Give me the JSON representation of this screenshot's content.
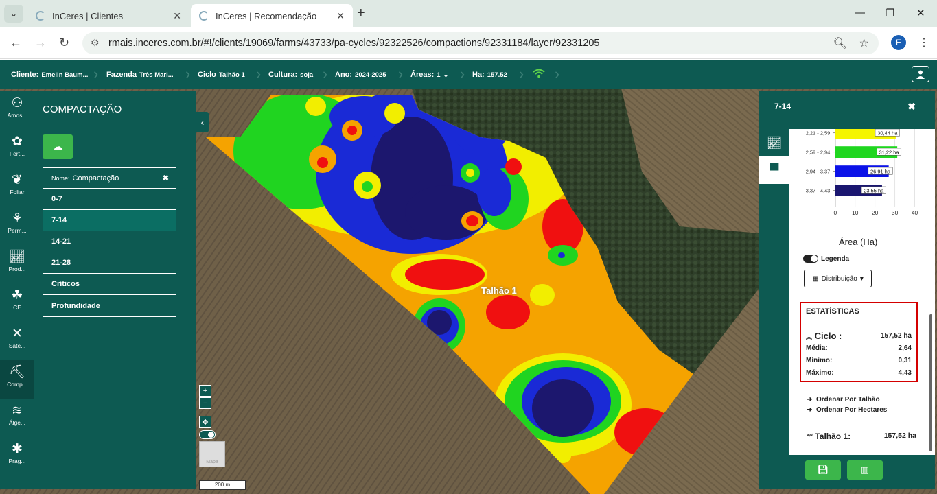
{
  "browser": {
    "tabs": [
      {
        "title": "InCeres | Clientes",
        "active": false
      },
      {
        "title": "InCeres | Recomendação",
        "active": true
      }
    ],
    "url": "rmais.inceres.com.br/#!/clients/19069/farms/43733/pa-cycles/92322526/compactions/92331184/layer/92331205",
    "profile_initial": "E"
  },
  "header": {
    "cliente_label": "Cliente:",
    "cliente_value": "Emelin Baum...",
    "fazenda_label": "Fazenda",
    "fazenda_value": "Três Mari...",
    "ciclo_label": "Ciclo",
    "ciclo_value": "Talhão 1",
    "cultura_label": "Cultura:",
    "cultura_value": "soja",
    "ano_label": "Ano:",
    "ano_value": "2024-2025",
    "areas_label": "Áreas:",
    "areas_value": "1",
    "ha_label": "Ha:",
    "ha_value": "157.52"
  },
  "sidebar": {
    "items": [
      {
        "label": "Amos...",
        "icon": "sample-icon"
      },
      {
        "label": "Fert...",
        "icon": "fertilizer-icon"
      },
      {
        "label": "Foliar",
        "icon": "leaf-icon"
      },
      {
        "label": "Perm...",
        "icon": "permission-icon"
      },
      {
        "label": "Prod...",
        "icon": "productivity-icon"
      },
      {
        "label": "CE",
        "icon": "sprout-icon"
      },
      {
        "label": "Sate...",
        "icon": "satellite-icon"
      },
      {
        "label": "Comp...",
        "icon": "compaction-icon"
      },
      {
        "label": "Álge...",
        "icon": "layers-icon"
      },
      {
        "label": "Prag...",
        "icon": "bug-icon"
      }
    ]
  },
  "left_panel": {
    "title": "COMPACTAÇÃO",
    "name_key": "Nome:",
    "name_value": "Compactação",
    "layers": [
      "0-7",
      "7-14",
      "14-21",
      "21-28",
      "Críticos",
      "Profundidade"
    ],
    "selected_layer": "7-14"
  },
  "map": {
    "plot_label": "Talhão 1",
    "scale_label": "200 m",
    "thumb_label": "Mapa"
  },
  "right_panel": {
    "title": "7-14",
    "axis_title": "Área (Ha)",
    "legend_toggle": "Legenda",
    "distribution_button": "Distribuição",
    "stats": {
      "title": "ESTATÍSTICAS",
      "ciclo_label": "Ciclo",
      "ciclo_value": "157,52 ha",
      "media_label": "Média:",
      "media_value": "2,64",
      "minimo_label": "Mínimo:",
      "minimo_value": "0,31",
      "maximo_label": "Máximo:",
      "maximo_value": "4,43"
    },
    "sort_by_plot": "Ordenar Por Talhão",
    "sort_by_hectares": "Ordenar Por Hectares",
    "talhao_label": "Talhão 1:",
    "talhao_value": "157,52 ha"
  },
  "chart_data": {
    "type": "bar",
    "orientation": "horizontal",
    "categories": [
      "2,21 - 2,59",
      "2,59 - 2,94",
      "2,94 - 3,37",
      "3,37 - 4,43"
    ],
    "values": [
      30.44,
      31.22,
      26.91,
      23.55
    ],
    "value_labels": [
      "30,44 ha",
      "31,22 ha",
      "26,91 ha",
      "23,55 ha"
    ],
    "colors": [
      "#f5f500",
      "#1fd61f",
      "#0b12e8",
      "#1a1670"
    ],
    "xlabel": "Área (Ha)",
    "xlim": [
      0,
      40
    ],
    "xticks": [
      0,
      10,
      20,
      30,
      40
    ],
    "grid": true
  }
}
